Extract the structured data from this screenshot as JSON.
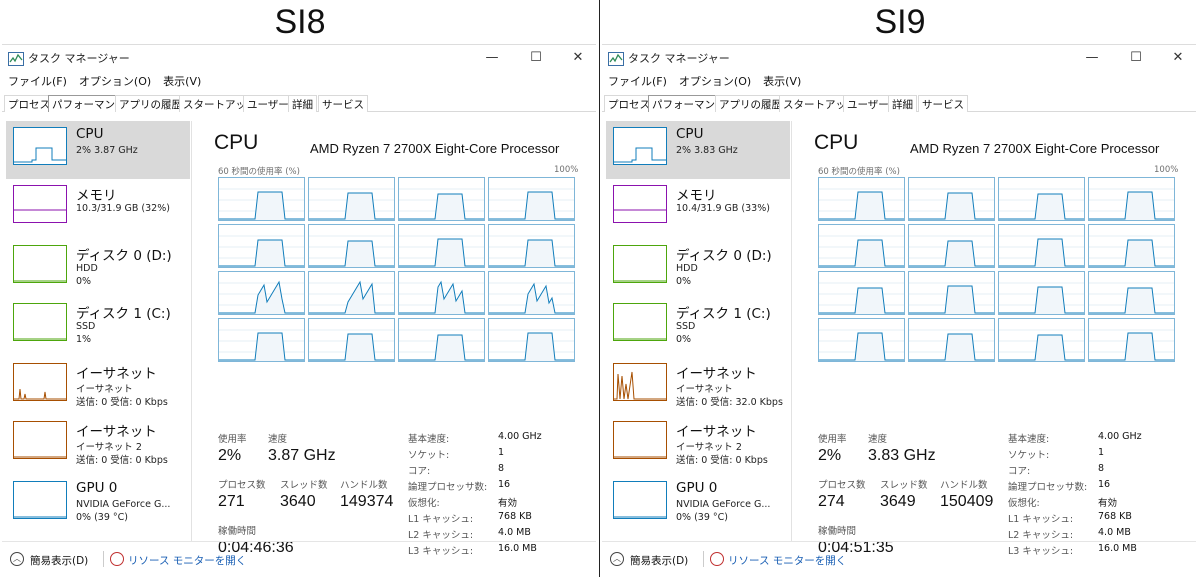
{
  "panels": [
    {
      "heading": "SI8",
      "window": {
        "title": "タスク マネージャー",
        "controls": [
          "—",
          "☐",
          "✕"
        ],
        "menu": [
          "ファイル(F)",
          "オプション(O)",
          "表示(V)"
        ],
        "tabs": [
          "プロセス",
          "パフォーマンス",
          "アプリの履歴",
          "スタートアップ",
          "ユーザー",
          "詳細",
          "サービス"
        ],
        "active_tab": 1
      },
      "sidebar": [
        {
          "name": "CPU",
          "line1": "2%  3.87 GHz",
          "line2": "",
          "color": "#117dbb",
          "active": true
        },
        {
          "name": "メモリ",
          "line1": "10.3/31.9 GB (32%)",
          "line2": "",
          "color": "#8b12ae",
          "active": false
        },
        {
          "name": "ディスク 0 (D:)",
          "line1": "HDD",
          "line2": "0%",
          "color": "#4da60c",
          "active": false
        },
        {
          "name": "ディスク 1 (C:)",
          "line1": "SSD",
          "line2": "1%",
          "color": "#4da60c",
          "active": false
        },
        {
          "name": "イーサネット",
          "line1": "イーサネット",
          "line2": "送信: 0  受信: 0 Kbps",
          "color": "#a74f01",
          "active": false
        },
        {
          "name": "イーサネット",
          "line1": "イーサネット 2",
          "line2": "送信: 0  受信: 0 Kbps",
          "color": "#a74f01",
          "active": false
        },
        {
          "name": "GPU 0",
          "line1": "NVIDIA GeForce G...",
          "line2": "0% (39 °C)",
          "color": "#117dbb",
          "active": false
        }
      ],
      "main": {
        "title": "CPU",
        "model": "AMD Ryzen 7 2700X Eight-Core Processor",
        "axis_label": "60 秒間の使用率 (%)",
        "axis_max": "100%",
        "stats": {
          "usage_label": "使用率",
          "usage": "2%",
          "speed_label": "速度",
          "speed": "3.87 GHz",
          "proc_label": "プロセス数",
          "proc": "271",
          "thread_label": "スレッド数",
          "thread": "3640",
          "handle_label": "ハンドル数",
          "handle": "149374",
          "uptime_label": "稼働時間",
          "uptime": "0:04:46:36"
        },
        "details": [
          {
            "label": "基本速度:",
            "value": "4.00 GHz"
          },
          {
            "label": "ソケット:",
            "value": "1"
          },
          {
            "label": "コア:",
            "value": "8"
          },
          {
            "label": "論理プロセッサ数:",
            "value": "16"
          },
          {
            "label": "仮想化:",
            "value": "有効"
          },
          {
            "label": "L1 キャッシュ:",
            "value": "768 KB"
          },
          {
            "label": "L2 キャッシュ:",
            "value": "4.0 MB"
          },
          {
            "label": "L3 キャッシュ:",
            "value": "16.0 MB"
          }
        ]
      },
      "footer": {
        "simple": "簡易表示(D)",
        "resmon": "リソース モニターを開く"
      }
    },
    {
      "heading": "SI9",
      "window": {
        "title": "タスク マネージャー",
        "controls": [
          "—",
          "☐",
          "✕"
        ],
        "menu": [
          "ファイル(F)",
          "オプション(O)",
          "表示(V)"
        ],
        "tabs": [
          "プロセス",
          "パフォーマンス",
          "アプリの履歴",
          "スタートアップ",
          "ユーザー",
          "詳細",
          "サービス"
        ],
        "active_tab": 1
      },
      "sidebar": [
        {
          "name": "CPU",
          "line1": "2%  3.83 GHz",
          "line2": "",
          "color": "#117dbb",
          "active": true
        },
        {
          "name": "メモリ",
          "line1": "10.4/31.9 GB (33%)",
          "line2": "",
          "color": "#8b12ae",
          "active": false
        },
        {
          "name": "ディスク 0 (D:)",
          "line1": "HDD",
          "line2": "0%",
          "color": "#4da60c",
          "active": false
        },
        {
          "name": "ディスク 1 (C:)",
          "line1": "SSD",
          "line2": "0%",
          "color": "#4da60c",
          "active": false
        },
        {
          "name": "イーサネット",
          "line1": "イーサネット",
          "line2": "送信: 0  受信: 32.0 Kbps",
          "color": "#a74f01",
          "active": false
        },
        {
          "name": "イーサネット",
          "line1": "イーサネット 2",
          "line2": "送信: 0  受信: 0 Kbps",
          "color": "#a74f01",
          "active": false
        },
        {
          "name": "GPU 0",
          "line1": "NVIDIA GeForce G...",
          "line2": "0% (39 °C)",
          "color": "#117dbb",
          "active": false
        }
      ],
      "main": {
        "title": "CPU",
        "model": "AMD Ryzen 7 2700X Eight-Core Processor",
        "axis_label": "60 秒間の使用率 (%)",
        "axis_max": "100%",
        "stats": {
          "usage_label": "使用率",
          "usage": "2%",
          "speed_label": "速度",
          "speed": "3.83 GHz",
          "proc_label": "プロセス数",
          "proc": "274",
          "thread_label": "スレッド数",
          "thread": "3649",
          "handle_label": "ハンドル数",
          "handle": "150409",
          "uptime_label": "稼働時間",
          "uptime": "0:04:51:35"
        },
        "details": [
          {
            "label": "基本速度:",
            "value": "4.00 GHz"
          },
          {
            "label": "ソケット:",
            "value": "1"
          },
          {
            "label": "コア:",
            "value": "8"
          },
          {
            "label": "論理プロセッサ数:",
            "value": "16"
          },
          {
            "label": "仮想化:",
            "value": "有効"
          },
          {
            "label": "L1 キャッシュ:",
            "value": "768 KB"
          },
          {
            "label": "L2 キャッシュ:",
            "value": "4.0 MB"
          },
          {
            "label": "L3 キャッシュ:",
            "value": "16.0 MB"
          }
        ]
      },
      "footer": {
        "simple": "簡易表示(D)",
        "resmon": "リソース モニターを開く"
      }
    }
  ],
  "theme": {
    "graph_line": "#117dbb",
    "graph_fill": "#f1f6fa",
    "graph_border": "#7fb6d8",
    "active_side": "#d9d9d9"
  }
}
